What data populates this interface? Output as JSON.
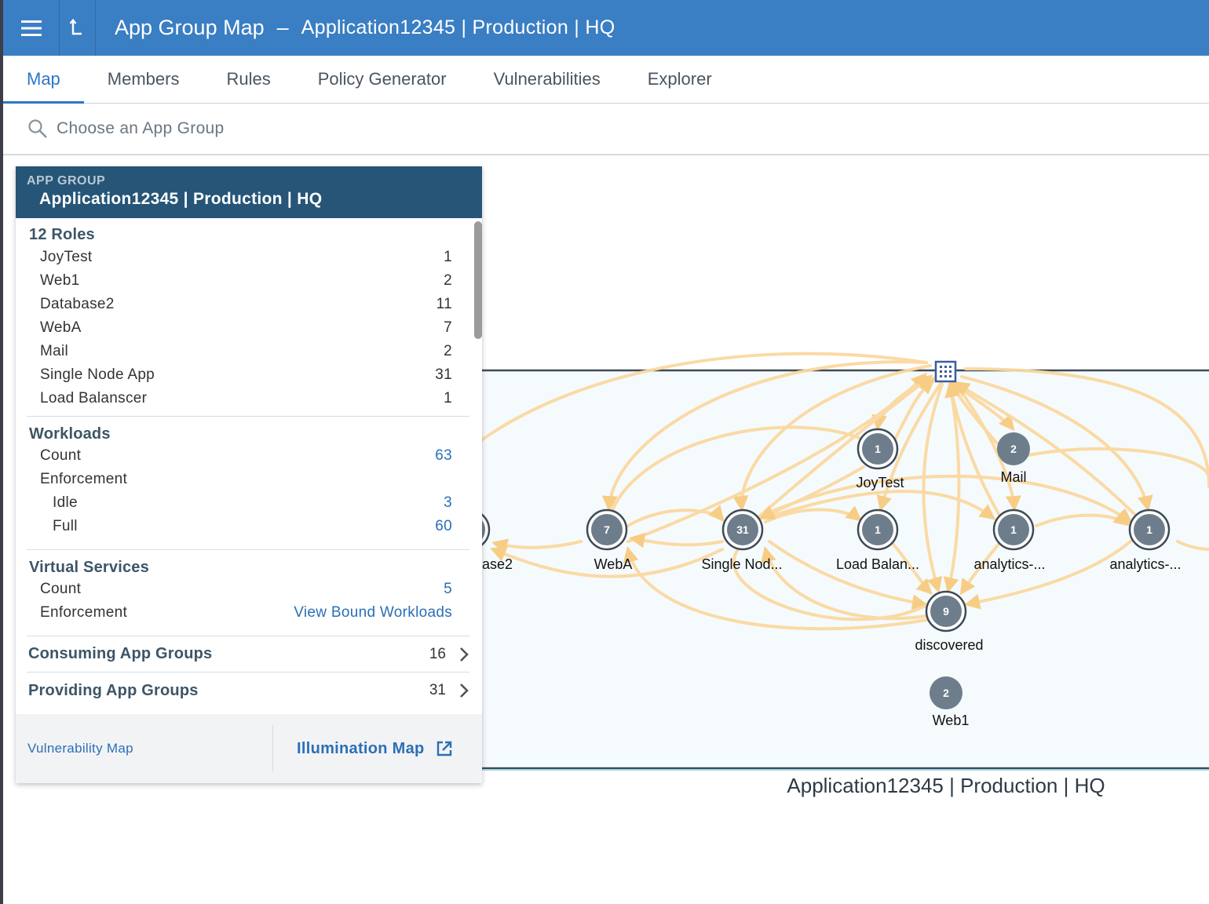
{
  "header": {
    "title": "App Group Map",
    "separator": "–",
    "context": "Application12345 | Production | HQ"
  },
  "tabs": [
    {
      "label": "Map",
      "active": true
    },
    {
      "label": "Members"
    },
    {
      "label": "Rules"
    },
    {
      "label": "Policy Generator"
    },
    {
      "label": "Vulnerabilities"
    },
    {
      "label": "Explorer"
    }
  ],
  "search": {
    "placeholder": "Choose an App Group"
  },
  "panel": {
    "header_label": "APP GROUP",
    "header_name": "Application12345 | Production | HQ",
    "roles": {
      "title": "12 Roles",
      "items": [
        {
          "label": "JoyTest",
          "value": "1"
        },
        {
          "label": "Web1",
          "value": "2"
        },
        {
          "label": "Database2",
          "value": "11"
        },
        {
          "label": "WebA",
          "value": "7"
        },
        {
          "label": "Mail",
          "value": "2"
        },
        {
          "label": "Single Node App",
          "value": "31"
        },
        {
          "label": "Load Balanscer",
          "value": "1"
        }
      ]
    },
    "workloads": {
      "title": "Workloads",
      "count_label": "Count",
      "count": "63",
      "enforcement_label": "Enforcement",
      "idle_label": "Idle",
      "idle": "3",
      "full_label": "Full",
      "full": "60"
    },
    "virtual_services": {
      "title": "Virtual Services",
      "count_label": "Count",
      "count": "5",
      "enforcement_label": "Enforcement",
      "enforcement_link": "View Bound Workloads"
    },
    "consuming": {
      "label": "Consuming App Groups",
      "value": "16"
    },
    "providing": {
      "label": "Providing App Groups",
      "value": "31"
    },
    "footer": {
      "vulnerability_map": "Vulnerability Map",
      "illumination_map": "Illumination Map"
    }
  },
  "map": {
    "group_label": "Application12345 | Production | HQ",
    "colors": {
      "edge": "#fbd9a0",
      "node": "#6e7d8c",
      "box_fill": "#f5fafd",
      "box_border": "#3f4a55"
    },
    "nodes": [
      {
        "id": "database2",
        "count": "",
        "label": "ase2"
      },
      {
        "id": "weba",
        "count": "7",
        "label": "WebA"
      },
      {
        "id": "single-node-app",
        "count": "31",
        "label": "Single Nod..."
      },
      {
        "id": "joytest",
        "count": "1",
        "label": "JoyTest"
      },
      {
        "id": "mail",
        "count": "2",
        "label": "Mail"
      },
      {
        "id": "load-balancer",
        "count": "1",
        "label": "Load Balan..."
      },
      {
        "id": "analytics-1",
        "count": "1",
        "label": "analytics-..."
      },
      {
        "id": "analytics-2",
        "count": "1",
        "label": "analytics-..."
      },
      {
        "id": "discovered",
        "count": "9",
        "label": "discovered"
      },
      {
        "id": "web1",
        "count": "2",
        "label": "Web1"
      }
    ]
  }
}
